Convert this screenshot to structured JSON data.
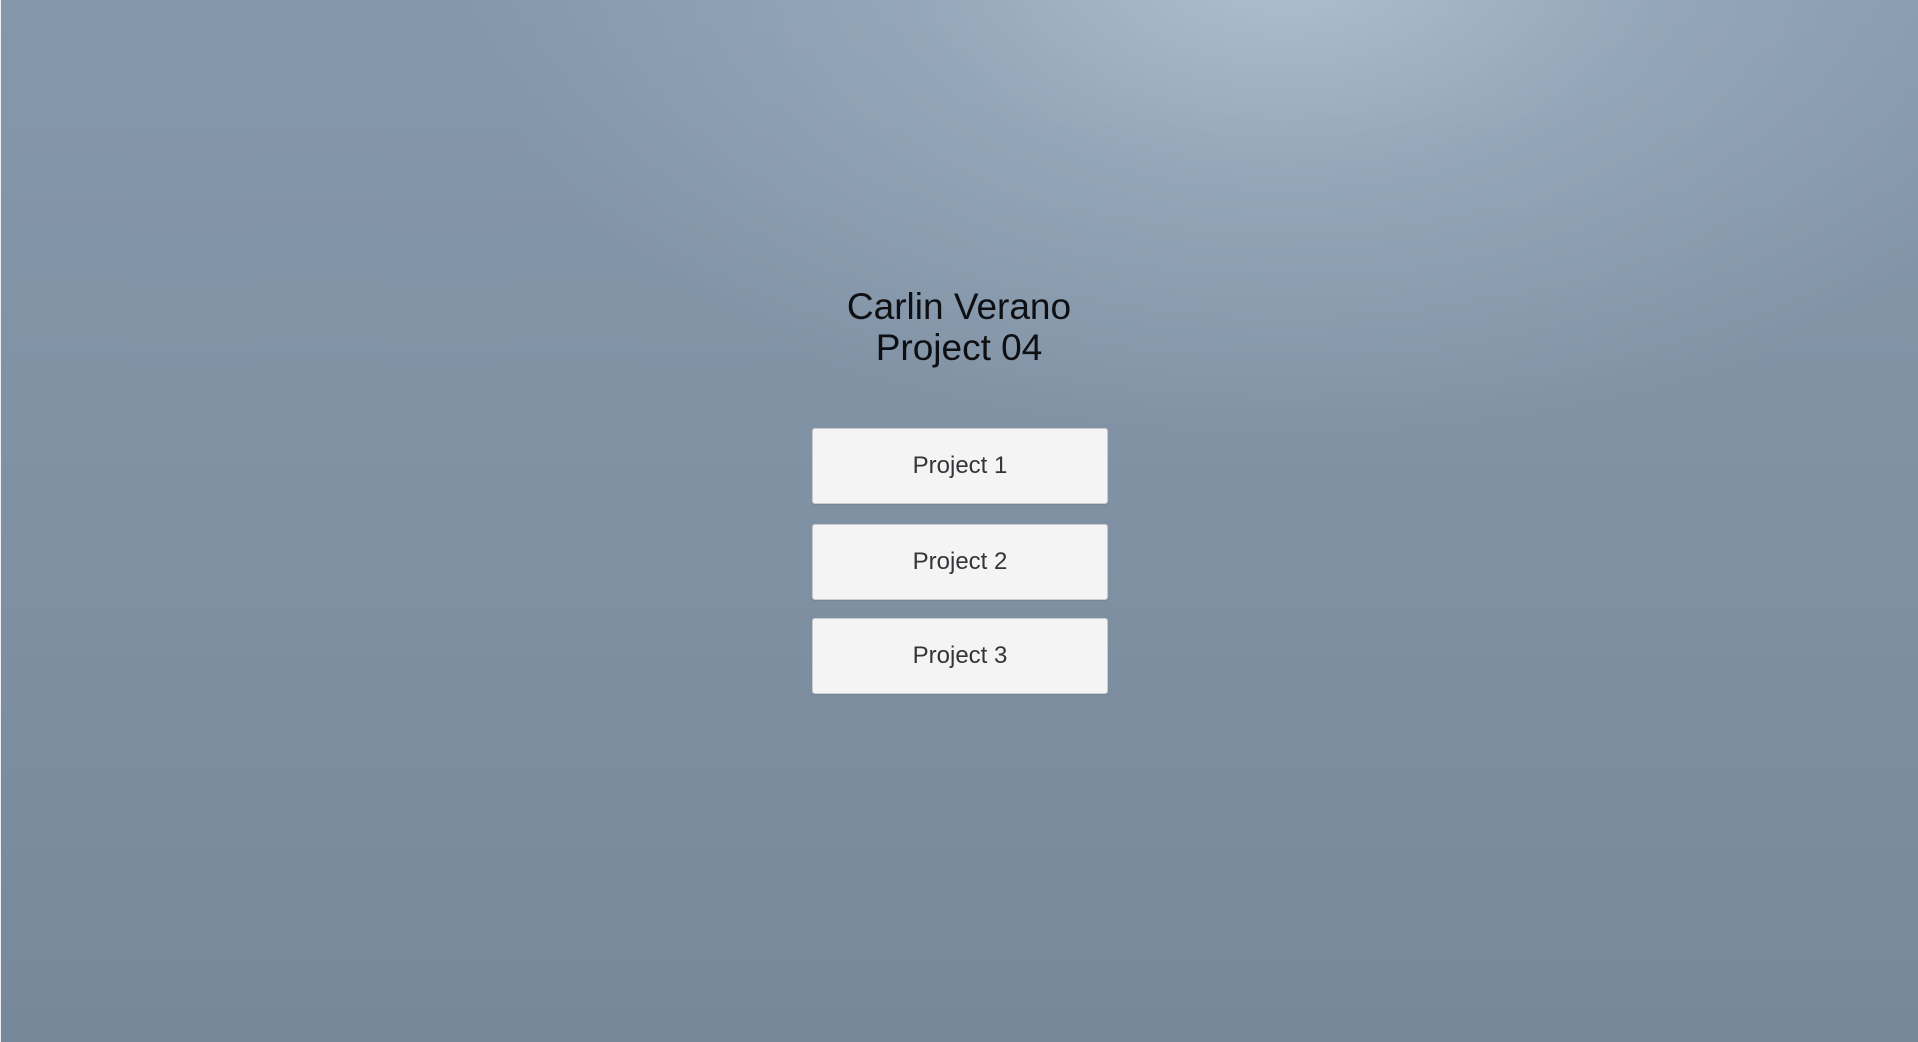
{
  "title": {
    "line1": "Carlin Verano",
    "line2": "Project 04"
  },
  "menu": {
    "buttons": [
      {
        "label": "Project 1"
      },
      {
        "label": "Project 2"
      },
      {
        "label": "Project 3"
      }
    ]
  },
  "colors": {
    "background_top_highlight": "#b2c2d2",
    "background_base": "#7f90a2",
    "button_fill": "#f4f4f5",
    "title_text": "#0d0f12",
    "button_text": "#333538"
  }
}
